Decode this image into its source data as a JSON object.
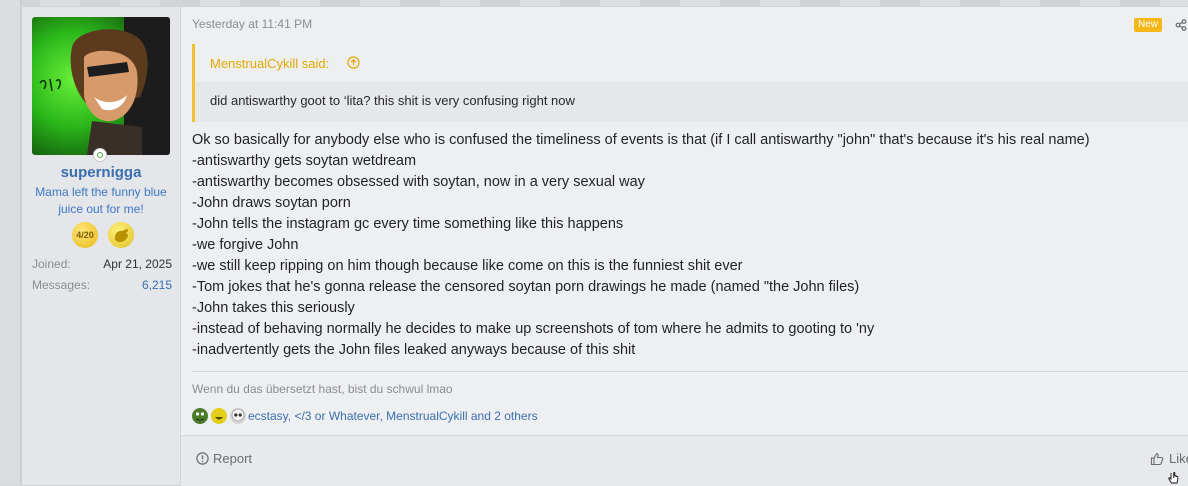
{
  "post": {
    "date": "Yesterday at 11:41 PM",
    "new_badge": "New",
    "user": {
      "name": "supernigga",
      "title": "Mama left the funny blue juice out for me!",
      "trophy_1_text": "4/20",
      "joined_label": "Joined:",
      "joined_value": "Apr 21, 2025",
      "messages_label": "Messages:",
      "messages_value": "6,215"
    },
    "quote": {
      "author": "MenstrualCykill said:",
      "text": "did antiswarthy goot to ‘lita? this shit is very confusing right now"
    },
    "body_lines": [
      "Ok so basically for anybody else who is confused the timeliness of events is that (if I call antiswarthy \"john\" that's because it's his real name)",
      "-antiswarthy gets soytan wetdream",
      "-antiswarthy becomes obsessed with soytan, now in a very sexual way",
      "-John draws soytan porn",
      "-John tells the instagram gc every time something like this happens",
      "-we forgive John",
      "-we still keep ripping on him though because like come on this is the funniest shit ever",
      "-Tom jokes that he's gonna release the censored soytan porn drawings he made (named \"the John files)",
      "-John takes this seriously",
      "-instead of behaving normally he decides to make up screenshots of tom where he admits to gooting to 'ny",
      "-inadvertently gets the John files leaked anyways because of this shit"
    ],
    "signature": "Wenn du das übersetzt hast, bist du schwul lmao",
    "reactions": {
      "users": "ecstasy, </3 or Whatever, MenstrualCykill and 2 others",
      "icons": [
        "frog-reaction-icon",
        "laugh-reaction-icon",
        "skull-reaction-icon"
      ]
    },
    "footer": {
      "report": "Report",
      "like": "Like"
    }
  },
  "colors": {
    "accent_link": "#3a6fb0",
    "quote_accent": "#f1c232",
    "new_badge": "#f5b617"
  }
}
